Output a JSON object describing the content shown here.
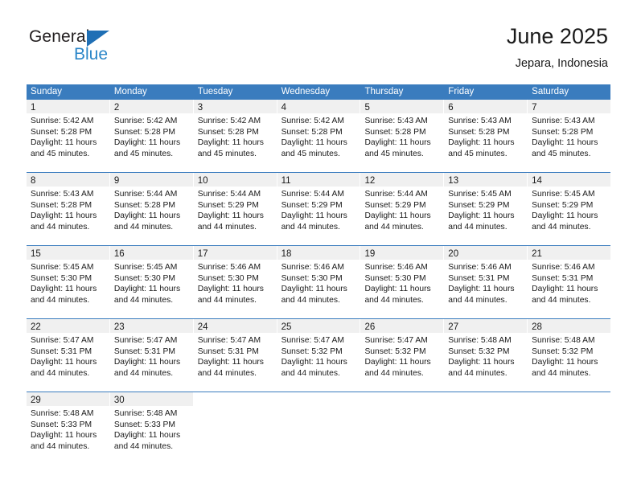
{
  "brand": {
    "name_top": "General",
    "name_bottom": "Blue",
    "triangle_color": "#1f6fb5",
    "blue_text_color": "#2b86c8"
  },
  "header": {
    "title": "June 2025",
    "subtitle": "Jepara, Indonesia"
  },
  "theme": {
    "header_bg": "#3a7cbe",
    "header_text": "#ffffff",
    "daynum_band": "#f0f0f0",
    "cell_bg": "#ffffff",
    "text": "#1a1a1a"
  },
  "weekdays": [
    "Sunday",
    "Monday",
    "Tuesday",
    "Wednesday",
    "Thursday",
    "Friday",
    "Saturday"
  ],
  "weeks": [
    [
      {
        "day": "1",
        "sunrise": "Sunrise: 5:42 AM",
        "sunset": "Sunset: 5:28 PM",
        "daylight1": "Daylight: 11 hours",
        "daylight2": "and 45 minutes."
      },
      {
        "day": "2",
        "sunrise": "Sunrise: 5:42 AM",
        "sunset": "Sunset: 5:28 PM",
        "daylight1": "Daylight: 11 hours",
        "daylight2": "and 45 minutes."
      },
      {
        "day": "3",
        "sunrise": "Sunrise: 5:42 AM",
        "sunset": "Sunset: 5:28 PM",
        "daylight1": "Daylight: 11 hours",
        "daylight2": "and 45 minutes."
      },
      {
        "day": "4",
        "sunrise": "Sunrise: 5:42 AM",
        "sunset": "Sunset: 5:28 PM",
        "daylight1": "Daylight: 11 hours",
        "daylight2": "and 45 minutes."
      },
      {
        "day": "5",
        "sunrise": "Sunrise: 5:43 AM",
        "sunset": "Sunset: 5:28 PM",
        "daylight1": "Daylight: 11 hours",
        "daylight2": "and 45 minutes."
      },
      {
        "day": "6",
        "sunrise": "Sunrise: 5:43 AM",
        "sunset": "Sunset: 5:28 PM",
        "daylight1": "Daylight: 11 hours",
        "daylight2": "and 45 minutes."
      },
      {
        "day": "7",
        "sunrise": "Sunrise: 5:43 AM",
        "sunset": "Sunset: 5:28 PM",
        "daylight1": "Daylight: 11 hours",
        "daylight2": "and 45 minutes."
      }
    ],
    [
      {
        "day": "8",
        "sunrise": "Sunrise: 5:43 AM",
        "sunset": "Sunset: 5:28 PM",
        "daylight1": "Daylight: 11 hours",
        "daylight2": "and 44 minutes."
      },
      {
        "day": "9",
        "sunrise": "Sunrise: 5:44 AM",
        "sunset": "Sunset: 5:28 PM",
        "daylight1": "Daylight: 11 hours",
        "daylight2": "and 44 minutes."
      },
      {
        "day": "10",
        "sunrise": "Sunrise: 5:44 AM",
        "sunset": "Sunset: 5:29 PM",
        "daylight1": "Daylight: 11 hours",
        "daylight2": "and 44 minutes."
      },
      {
        "day": "11",
        "sunrise": "Sunrise: 5:44 AM",
        "sunset": "Sunset: 5:29 PM",
        "daylight1": "Daylight: 11 hours",
        "daylight2": "and 44 minutes."
      },
      {
        "day": "12",
        "sunrise": "Sunrise: 5:44 AM",
        "sunset": "Sunset: 5:29 PM",
        "daylight1": "Daylight: 11 hours",
        "daylight2": "and 44 minutes."
      },
      {
        "day": "13",
        "sunrise": "Sunrise: 5:45 AM",
        "sunset": "Sunset: 5:29 PM",
        "daylight1": "Daylight: 11 hours",
        "daylight2": "and 44 minutes."
      },
      {
        "day": "14",
        "sunrise": "Sunrise: 5:45 AM",
        "sunset": "Sunset: 5:29 PM",
        "daylight1": "Daylight: 11 hours",
        "daylight2": "and 44 minutes."
      }
    ],
    [
      {
        "day": "15",
        "sunrise": "Sunrise: 5:45 AM",
        "sunset": "Sunset: 5:30 PM",
        "daylight1": "Daylight: 11 hours",
        "daylight2": "and 44 minutes."
      },
      {
        "day": "16",
        "sunrise": "Sunrise: 5:45 AM",
        "sunset": "Sunset: 5:30 PM",
        "daylight1": "Daylight: 11 hours",
        "daylight2": "and 44 minutes."
      },
      {
        "day": "17",
        "sunrise": "Sunrise: 5:46 AM",
        "sunset": "Sunset: 5:30 PM",
        "daylight1": "Daylight: 11 hours",
        "daylight2": "and 44 minutes."
      },
      {
        "day": "18",
        "sunrise": "Sunrise: 5:46 AM",
        "sunset": "Sunset: 5:30 PM",
        "daylight1": "Daylight: 11 hours",
        "daylight2": "and 44 minutes."
      },
      {
        "day": "19",
        "sunrise": "Sunrise: 5:46 AM",
        "sunset": "Sunset: 5:30 PM",
        "daylight1": "Daylight: 11 hours",
        "daylight2": "and 44 minutes."
      },
      {
        "day": "20",
        "sunrise": "Sunrise: 5:46 AM",
        "sunset": "Sunset: 5:31 PM",
        "daylight1": "Daylight: 11 hours",
        "daylight2": "and 44 minutes."
      },
      {
        "day": "21",
        "sunrise": "Sunrise: 5:46 AM",
        "sunset": "Sunset: 5:31 PM",
        "daylight1": "Daylight: 11 hours",
        "daylight2": "and 44 minutes."
      }
    ],
    [
      {
        "day": "22",
        "sunrise": "Sunrise: 5:47 AM",
        "sunset": "Sunset: 5:31 PM",
        "daylight1": "Daylight: 11 hours",
        "daylight2": "and 44 minutes."
      },
      {
        "day": "23",
        "sunrise": "Sunrise: 5:47 AM",
        "sunset": "Sunset: 5:31 PM",
        "daylight1": "Daylight: 11 hours",
        "daylight2": "and 44 minutes."
      },
      {
        "day": "24",
        "sunrise": "Sunrise: 5:47 AM",
        "sunset": "Sunset: 5:31 PM",
        "daylight1": "Daylight: 11 hours",
        "daylight2": "and 44 minutes."
      },
      {
        "day": "25",
        "sunrise": "Sunrise: 5:47 AM",
        "sunset": "Sunset: 5:32 PM",
        "daylight1": "Daylight: 11 hours",
        "daylight2": "and 44 minutes."
      },
      {
        "day": "26",
        "sunrise": "Sunrise: 5:47 AM",
        "sunset": "Sunset: 5:32 PM",
        "daylight1": "Daylight: 11 hours",
        "daylight2": "and 44 minutes."
      },
      {
        "day": "27",
        "sunrise": "Sunrise: 5:48 AM",
        "sunset": "Sunset: 5:32 PM",
        "daylight1": "Daylight: 11 hours",
        "daylight2": "and 44 minutes."
      },
      {
        "day": "28",
        "sunrise": "Sunrise: 5:48 AM",
        "sunset": "Sunset: 5:32 PM",
        "daylight1": "Daylight: 11 hours",
        "daylight2": "and 44 minutes."
      }
    ],
    [
      {
        "day": "29",
        "sunrise": "Sunrise: 5:48 AM",
        "sunset": "Sunset: 5:33 PM",
        "daylight1": "Daylight: 11 hours",
        "daylight2": "and 44 minutes."
      },
      {
        "day": "30",
        "sunrise": "Sunrise: 5:48 AM",
        "sunset": "Sunset: 5:33 PM",
        "daylight1": "Daylight: 11 hours",
        "daylight2": "and 44 minutes."
      },
      {
        "day": "",
        "sunrise": "",
        "sunset": "",
        "daylight1": "",
        "daylight2": ""
      },
      {
        "day": "",
        "sunrise": "",
        "sunset": "",
        "daylight1": "",
        "daylight2": ""
      },
      {
        "day": "",
        "sunrise": "",
        "sunset": "",
        "daylight1": "",
        "daylight2": ""
      },
      {
        "day": "",
        "sunrise": "",
        "sunset": "",
        "daylight1": "",
        "daylight2": ""
      },
      {
        "day": "",
        "sunrise": "",
        "sunset": "",
        "daylight1": "",
        "daylight2": ""
      }
    ]
  ]
}
